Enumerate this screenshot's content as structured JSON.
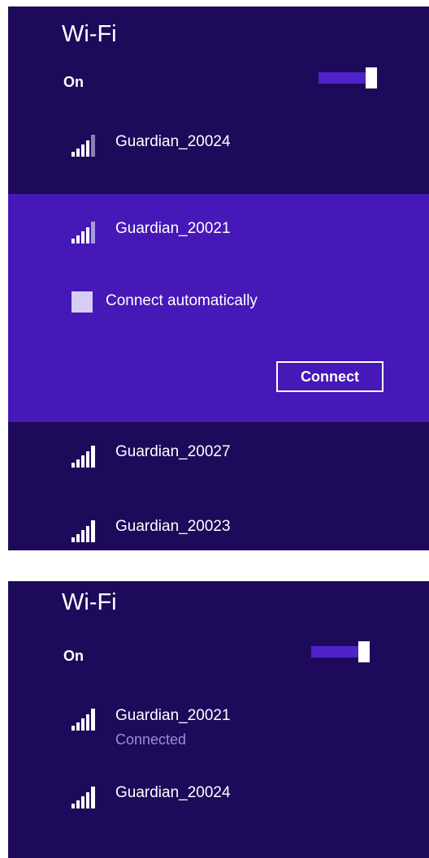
{
  "screen_top": {
    "title": "Wi-Fi",
    "wifi_state_label": "On",
    "networks_above": [
      {
        "name": "Guardian_20024"
      }
    ],
    "selected_network": {
      "name": "Guardian_20021",
      "connect_automatically_label": "Connect automatically",
      "connect_button_label": "Connect"
    },
    "networks_below": [
      {
        "name": "Guardian_20027"
      },
      {
        "name": "Guardian_20023"
      }
    ]
  },
  "screen_bottom": {
    "title": "Wi-Fi",
    "wifi_state_label": "On",
    "networks": [
      {
        "name": "Guardian_20021",
        "status": "Connected"
      },
      {
        "name": "Guardian_20024"
      }
    ]
  },
  "colors": {
    "panel_bg": "#1e0a5a",
    "selected_bg": "#4618b8",
    "toggle_track": "#4f23c9",
    "status_text": "#9c8dd8"
  },
  "icons": [
    "wifi-signal-icon",
    "toggle-switch"
  ]
}
